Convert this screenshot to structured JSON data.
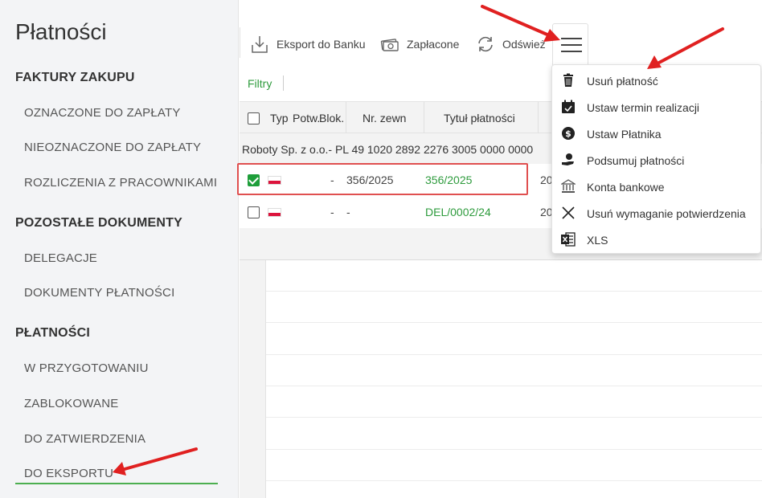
{
  "sidebar": {
    "title": "Płatności",
    "sections": [
      {
        "heading": "FAKTURY ZAKUPU",
        "items": [
          "OZNACZONE DO ZAPŁATY",
          "NIEOZNACZONE DO ZAPŁATY",
          "ROZLICZENIA Z PRACOWNIKAMI"
        ]
      },
      {
        "heading": "POZOSTAŁE DOKUMENTY",
        "items": [
          "DELEGACJE",
          "DOKUMENTY PŁATNOŚCI"
        ]
      },
      {
        "heading": "PŁATNOŚCI",
        "items": [
          "W PRZYGOTOWANIU",
          "ZABLOKOWANE",
          "DO ZATWIERDZENIA",
          "DO EKSPORTU"
        ]
      }
    ],
    "active_item": "DO EKSPORTU",
    "accent_color": "#4caf50"
  },
  "toolbar": {
    "export_label": "Eksport do Banku",
    "paid_label": "Zapłacone",
    "refresh_label": "Odśwież",
    "menu_icon": "hamburger-icon"
  },
  "filters": {
    "label": "Filtry"
  },
  "table": {
    "columns": [
      "Typ",
      "Potw.",
      "Blok.",
      "Nr. zewn",
      "Tytuł płatności"
    ],
    "group_label": "Roboty Sp. z o.o.- PL 49 1020 2892 2276 3005 0000 0000",
    "rows": [
      {
        "checked": true,
        "flag": "PL",
        "blok": "-",
        "nr_zewn": "356/2025",
        "tytul": "356/2025",
        "extra": "20"
      },
      {
        "checked": false,
        "flag": "PL",
        "blok": "-",
        "nr_zewn": "-",
        "tytul": "DEL/0002/24",
        "extra": "20"
      }
    ]
  },
  "dropdown": {
    "items": [
      {
        "label": "Usuń płatność",
        "icon": "trash-icon"
      },
      {
        "label": "Ustaw termin realizacji",
        "icon": "calendar-check-icon"
      },
      {
        "label": "Ustaw Płatnika",
        "icon": "dollar-circle-icon"
      },
      {
        "label": "Podsumuj płatności",
        "icon": "hand-coins-icon"
      },
      {
        "label": "Konta bankowe",
        "icon": "bank-icon"
      },
      {
        "label": "Usuń wymaganie potwierdzenia",
        "icon": "close-icon"
      },
      {
        "label": "XLS",
        "icon": "excel-icon"
      }
    ]
  },
  "colors": {
    "green": "#2e9b3d",
    "annotation_red": "#e02020"
  }
}
